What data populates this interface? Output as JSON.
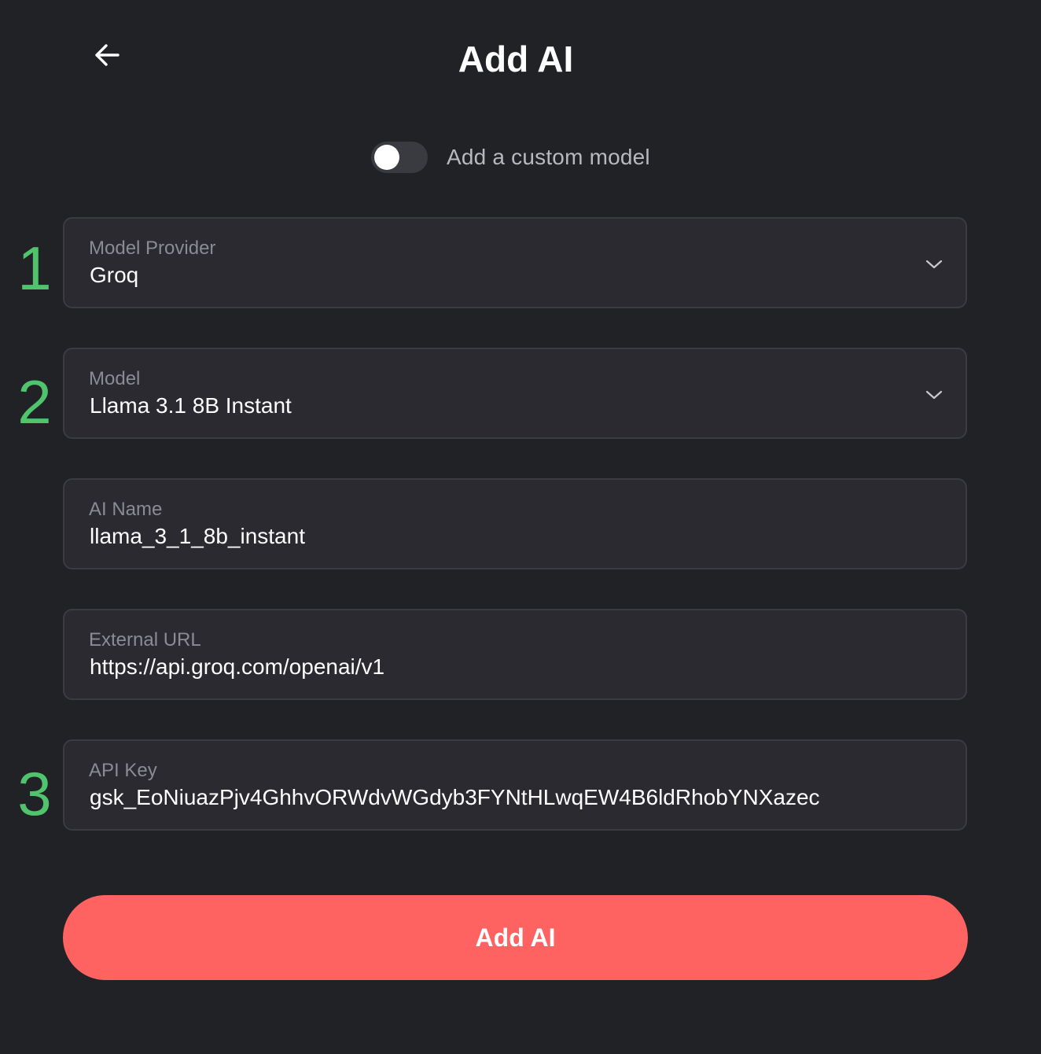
{
  "header": {
    "title": "Add AI",
    "back_icon": "arrow-left-icon"
  },
  "custom_model_toggle": {
    "label": "Add a custom model",
    "enabled": false
  },
  "step_markers": [
    "1",
    "2",
    "3"
  ],
  "fields": {
    "provider": {
      "label": "Model Provider",
      "value": "Groq"
    },
    "model": {
      "label": "Model",
      "value": "Llama 3.1 8B Instant"
    },
    "ai_name": {
      "label": "AI Name",
      "value": "llama_3_1_8b_instant"
    },
    "external_url": {
      "label": "External URL",
      "value": "https://api.groq.com/openai/v1"
    },
    "api_key": {
      "label": "API Key",
      "value": "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"
    }
  },
  "submit": {
    "label": "Add AI"
  },
  "colors": {
    "background": "#212225",
    "field_background": "#2a2a30",
    "field_border": "#3b3c42",
    "step_marker": "#4fc46c",
    "primary_button": "#fe6362"
  }
}
